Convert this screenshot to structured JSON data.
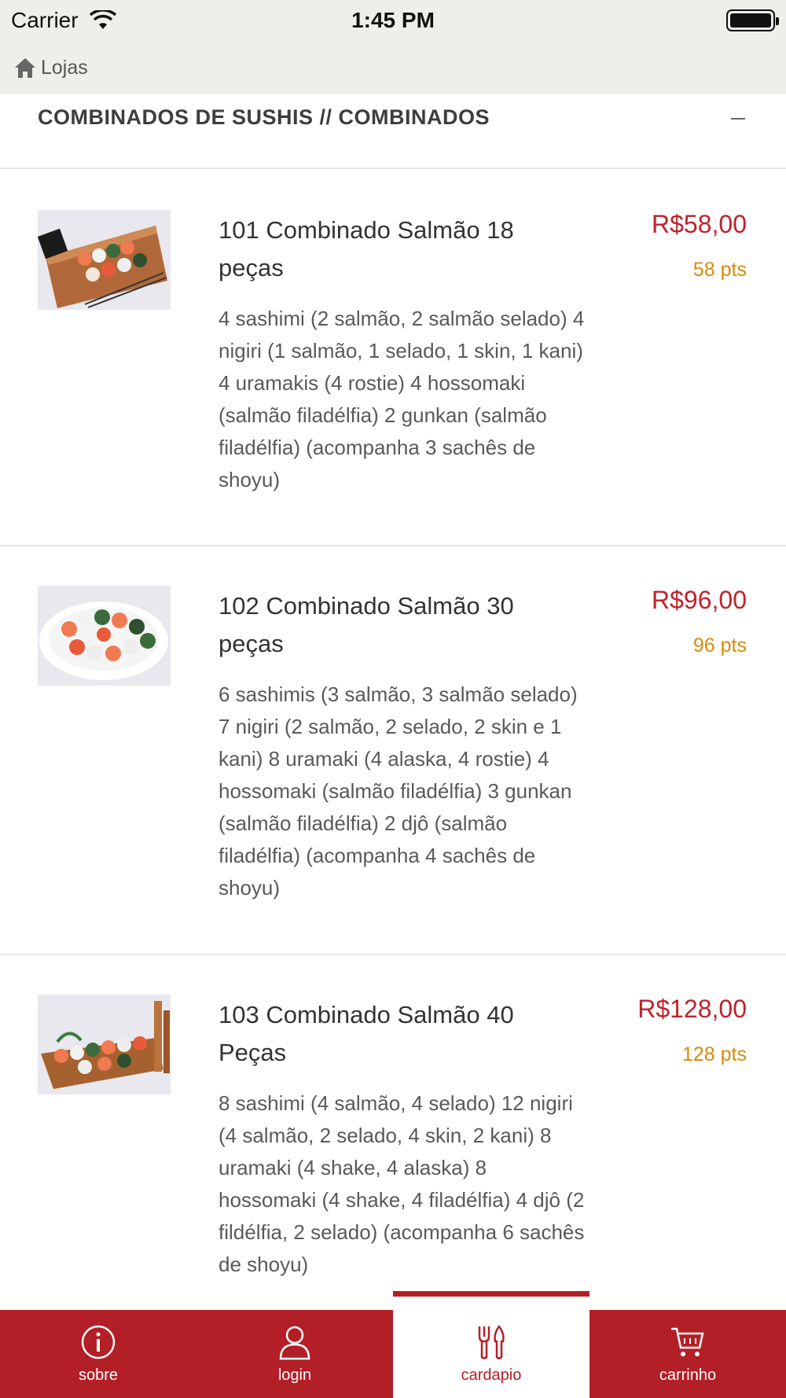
{
  "status_bar": {
    "carrier": "Carrier",
    "time": "1:45 PM"
  },
  "nav": {
    "back_label": "Lojas"
  },
  "section": {
    "title": "COMBINADOS DE SUSHIS // COMBINADOS",
    "toggle_symbol": "–"
  },
  "products": [
    {
      "name": "101 Combinado Salmão 18 peças",
      "description": "4 sashimi (2 salmão, 2 salmão selado) 4 nigiri (1 salmão, 1 selado, 1 skin, 1 kani) 4 uramakis (4 rostie) 4 hossomaki (salmão filadélfia) 2 gunkan (salmão filadélfia) (acompanha 3 sachês de shoyu)",
      "price": "R$58,00",
      "points": "58 pts"
    },
    {
      "name": "102 Combinado Salmão 30 peças",
      "description": "6 sashimis (3 salmão, 3 salmão selado) 7 nigiri (2 salmão, 2 selado, 2 skin e 1 kani) 8 uramaki (4 alaska, 4 rostie) 4 hossomaki (salmão filadélfia) 3 gunkan (salmão filadélfia) 2 djô (salmão filadélfia) (acompanha 4 sachês de shoyu)",
      "price": "R$96,00",
      "points": "96 pts"
    },
    {
      "name": "103 Combinado Salmão 40 Peças",
      "description": "8 sashimi (4 salmão, 4 selado) 12 nigiri (4 salmão, 2 selado, 4 skin, 2 kani) 8 uramaki (4 shake, 4 alaska) 8 hossomaki (4 shake, 4 filadélfia) 4 djô (2 fildélfia, 2 selado) (acompanha 6 sachês de shoyu)",
      "price": "R$128,00",
      "points": "128 pts"
    }
  ],
  "tabs": [
    {
      "label": "sobre",
      "icon": "info-icon"
    },
    {
      "label": "login",
      "icon": "user-icon"
    },
    {
      "label": "cardapio",
      "icon": "utensils-icon",
      "active": true
    },
    {
      "label": "carrinho",
      "icon": "cart-icon"
    }
  ],
  "colors": {
    "brand_red": "#b31f27",
    "price_red": "#c0222a",
    "points_orange": "#d88a08",
    "header_bg": "#eeeeea"
  }
}
